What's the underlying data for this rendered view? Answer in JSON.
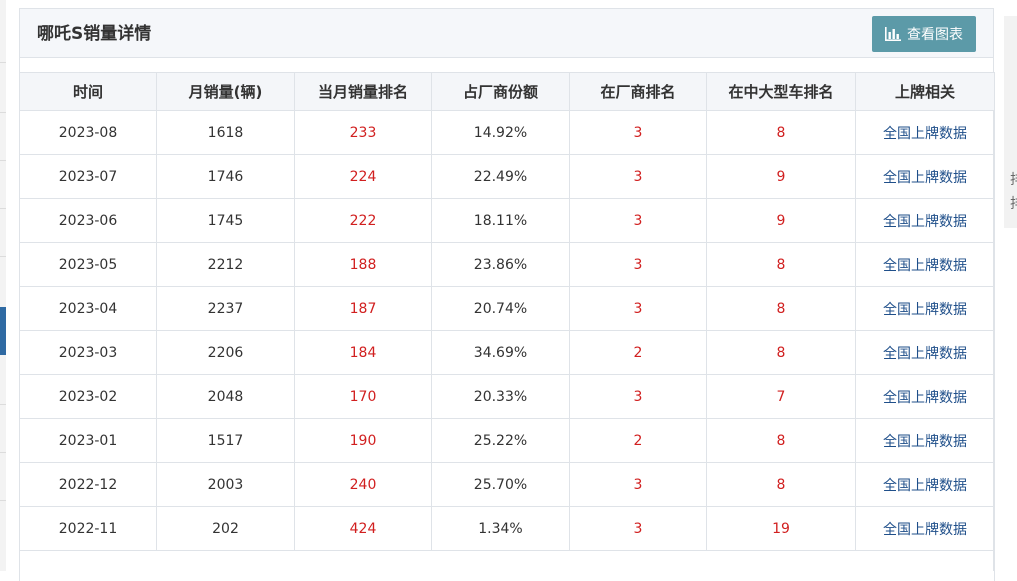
{
  "header": {
    "title": "哪吒S销量详情",
    "chart_button_label": "查看图表",
    "chart_button_icon": "bar-chart-icon"
  },
  "side_fragment": {
    "char_1": "排",
    "char_2": "排"
  },
  "table": {
    "columns": [
      "时间",
      "月销量(辆)",
      "当月销量排名",
      "占厂商份额",
      "在厂商排名",
      "在中大型车排名",
      "上牌相关"
    ],
    "rows": [
      {
        "time": "2023-08",
        "sales": "1618",
        "rank_month": "233",
        "share": "14.92%",
        "rank_maker": "3",
        "rank_class": "8",
        "link": "全国上牌数据"
      },
      {
        "time": "2023-07",
        "sales": "1746",
        "rank_month": "224",
        "share": "22.49%",
        "rank_maker": "3",
        "rank_class": "9",
        "link": "全国上牌数据"
      },
      {
        "time": "2023-06",
        "sales": "1745",
        "rank_month": "222",
        "share": "18.11%",
        "rank_maker": "3",
        "rank_class": "9",
        "link": "全国上牌数据"
      },
      {
        "time": "2023-05",
        "sales": "2212",
        "rank_month": "188",
        "share": "23.86%",
        "rank_maker": "3",
        "rank_class": "8",
        "link": "全国上牌数据"
      },
      {
        "time": "2023-04",
        "sales": "2237",
        "rank_month": "187",
        "share": "20.74%",
        "rank_maker": "3",
        "rank_class": "8",
        "link": "全国上牌数据"
      },
      {
        "time": "2023-03",
        "sales": "2206",
        "rank_month": "184",
        "share": "34.69%",
        "rank_maker": "2",
        "rank_class": "8",
        "link": "全国上牌数据"
      },
      {
        "time": "2023-02",
        "sales": "2048",
        "rank_month": "170",
        "share": "20.33%",
        "rank_maker": "3",
        "rank_class": "7",
        "link": "全国上牌数据"
      },
      {
        "time": "2023-01",
        "sales": "1517",
        "rank_month": "190",
        "share": "25.22%",
        "rank_maker": "2",
        "rank_class": "8",
        "link": "全国上牌数据"
      },
      {
        "time": "2022-12",
        "sales": "2003",
        "rank_month": "240",
        "share": "25.70%",
        "rank_maker": "3",
        "rank_class": "8",
        "link": "全国上牌数据"
      },
      {
        "time": "2022-11",
        "sales": "202",
        "rank_month": "424",
        "share": "1.34%",
        "rank_maker": "3",
        "rank_class": "19",
        "link": "全国上牌数据"
      }
    ]
  },
  "colors": {
    "accent_button": "#5c9aa8",
    "rank_red": "#d11f1f",
    "link_blue": "#1f4f8a",
    "header_bg": "#f5f7fa",
    "border": "#dfe3e8"
  }
}
